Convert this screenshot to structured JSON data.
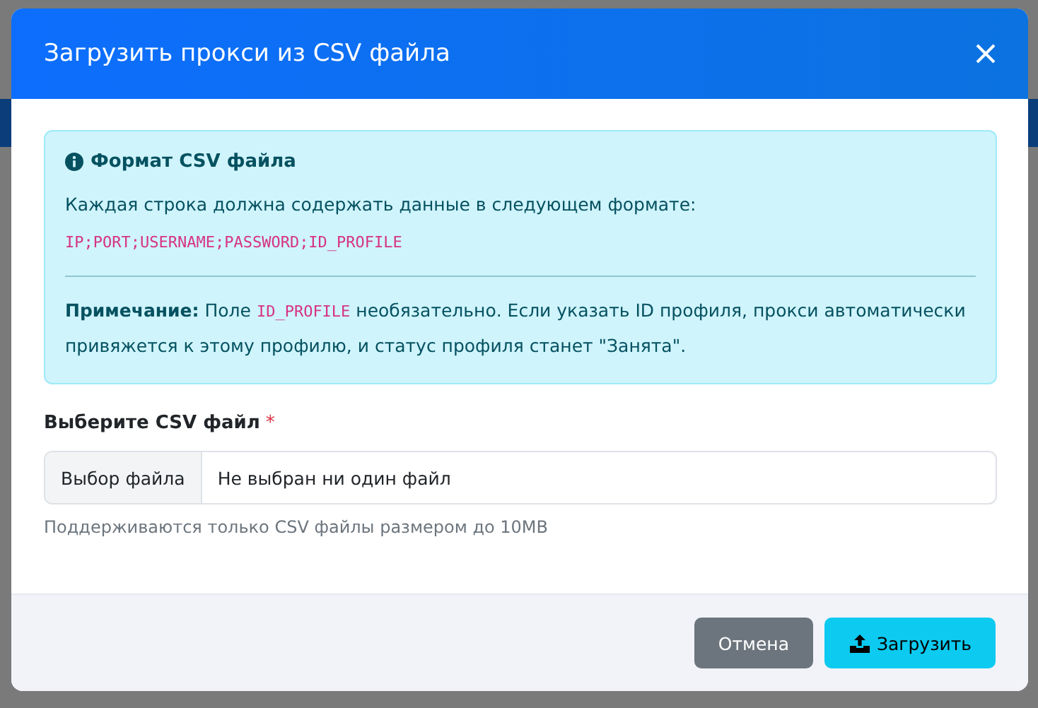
{
  "modal": {
    "title": "Загрузить прокси из CSV файла",
    "alert": {
      "heading": "Формат CSV файла",
      "intro": "Каждая строка должна содержать данные в следующем формате:",
      "format": "IP;PORT;USERNAME;PASSWORD;ID_PROFILE",
      "note": "**Примечание:** Поле ",
      "note_code": "ID_PROFILE",
      "note_rest": " необязательно. Если указать ID профиля, прокси автоматически привяжется к этому профилю, и статус профиля станет \"Занята\"."
    },
    "field": {
      "label": "Выберите CSV файл",
      "required_mark": "*",
      "button": "Выбор файла",
      "value": "Не выбран ни один файл",
      "help": "Поддерживаются только CSV файлы размером до 10MB"
    },
    "buttons": [
      {
        "kind": "secondary",
        "label": "Отмена"
      },
      {
        "kind": "primary",
        "label": "Загрузить"
      }
    ]
  }
}
